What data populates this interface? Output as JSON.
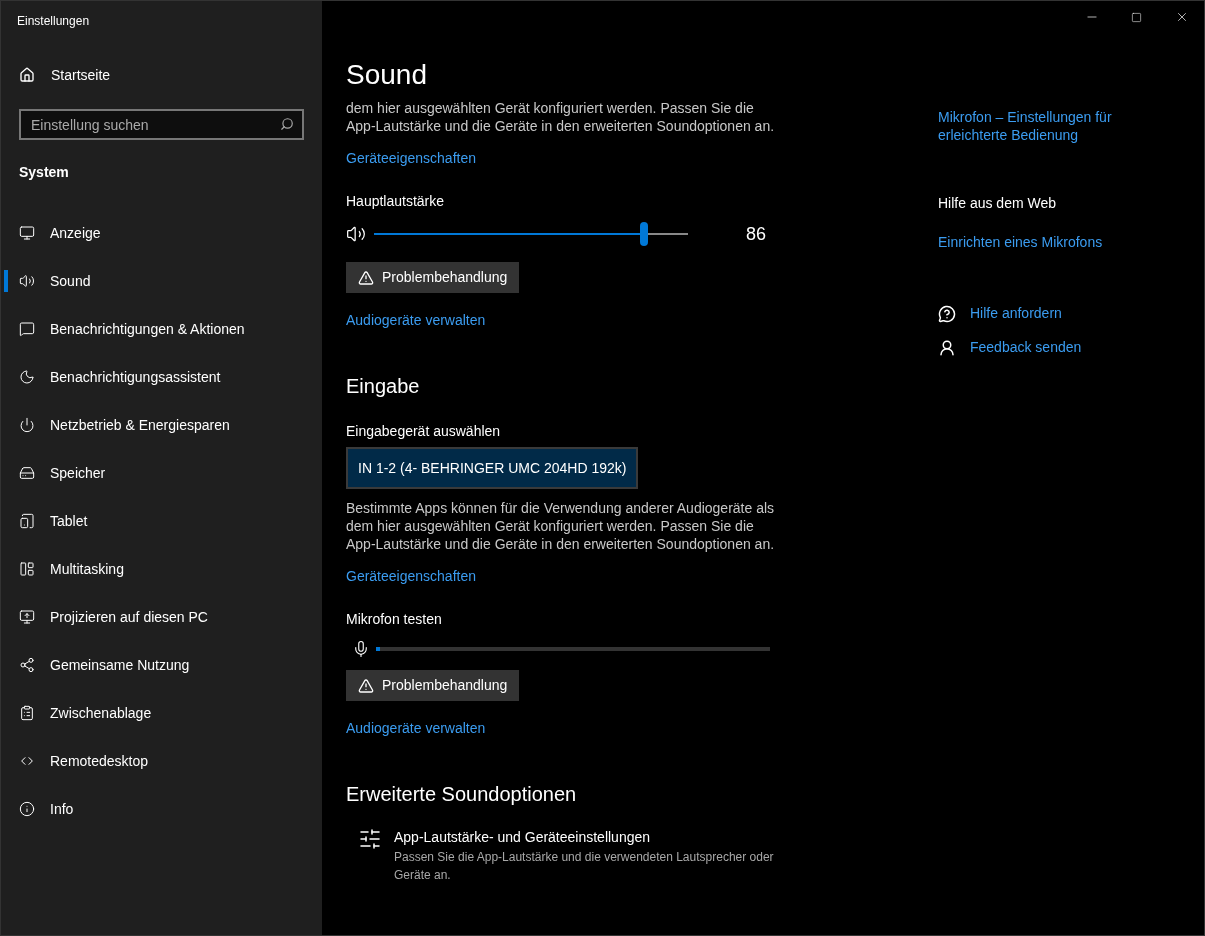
{
  "window": {
    "title": "Einstellungen"
  },
  "sidebar": {
    "home": "Startseite",
    "search": {
      "placeholder": "Einstellung suchen"
    },
    "section": "System",
    "items": [
      {
        "label": "Anzeige",
        "selected": false
      },
      {
        "label": "Sound",
        "selected": true
      },
      {
        "label": "Benachrichtigungen & Aktionen",
        "selected": false
      },
      {
        "label": "Benachrichtigungsassistent",
        "selected": false
      },
      {
        "label": "Netzbetrieb & Energiesparen",
        "selected": false
      },
      {
        "label": "Speicher",
        "selected": false
      },
      {
        "label": "Tablet",
        "selected": false
      },
      {
        "label": "Multitasking",
        "selected": false
      },
      {
        "label": "Projizieren auf diesen PC",
        "selected": false
      },
      {
        "label": "Gemeinsame Nutzung",
        "selected": false
      },
      {
        "label": "Zwischenablage",
        "selected": false
      },
      {
        "label": "Remotedesktop",
        "selected": false
      },
      {
        "label": "Info",
        "selected": false
      }
    ]
  },
  "page": {
    "title": "Sound",
    "output": {
      "description": "dem hier ausgewählten Gerät konfiguriert werden. Passen Sie die App-Lautstärke und die Geräte in den erweiterten Soundoptionen an.",
      "properties_link": "Geräteeigenschaften",
      "volume_label": "Hauptlautstärke",
      "volume": {
        "level": 0.86,
        "reading": "86"
      },
      "troubleshoot": "Problembehandlung",
      "manage_link": "Audiogeräte verwalten"
    },
    "input": {
      "heading": "Eingabe",
      "device_label": "Eingabegerät auswählen",
      "device": "IN 1-2 (4- BEHRINGER UMC 204HD 192k)",
      "description": "Bestimmte Apps können für die Verwendung anderer Audiogeräte als dem hier ausgewählten Gerät konfiguriert werden. Passen Sie die App-Lautstärke und die Geräte in den erweiterten Soundoptionen an.",
      "properties_link": "Geräteeigenschaften",
      "test_label": "Mikrofon testen",
      "mic": {
        "level": 0.01
      },
      "troubleshoot": "Problembehandlung",
      "manage_link": "Audiogeräte verwalten"
    },
    "advanced": {
      "heading": "Erweiterte Soundoptionen",
      "title": "App-Lautstärke- und Geräteeinstellungen",
      "description": "Passen Sie die App-Lautstärke und die verwendeten Lautsprecher oder Geräte an."
    }
  },
  "related": {
    "accessibility_link": "Mikrofon – Einstellungen für erleichterte Bedienung",
    "web_heading": "Hilfe aus dem Web",
    "web_link": "Einrichten eines Mikrofons",
    "help": "Hilfe anfordern",
    "feedback": "Feedback senden"
  }
}
